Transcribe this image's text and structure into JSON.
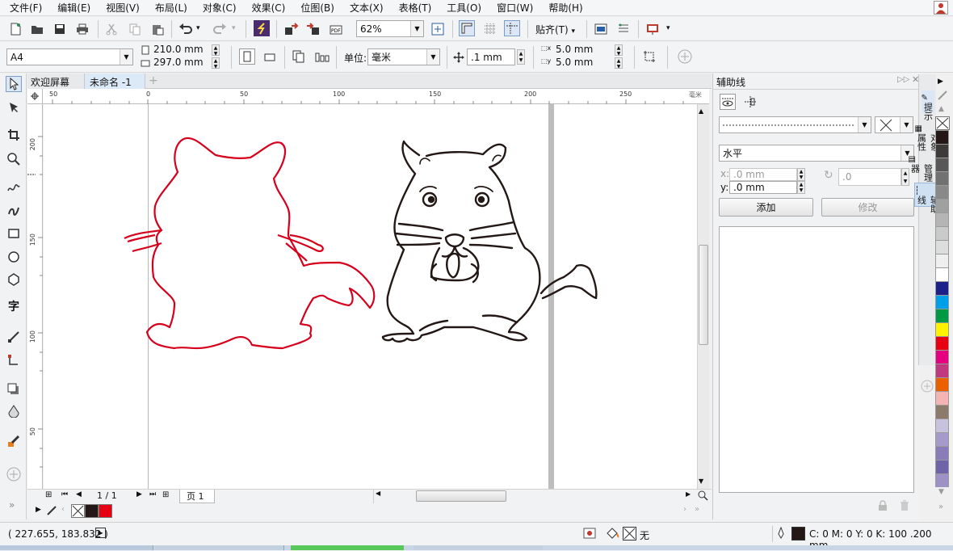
{
  "menu": [
    "文件(F)",
    "编辑(E)",
    "视图(V)",
    "布局(L)",
    "对象(C)",
    "效果(C)",
    "位图(B)",
    "文本(X)",
    "表格(T)",
    "工具(O)",
    "窗口(W)",
    "帮助(H)"
  ],
  "toolbar": {
    "zoom": "62%",
    "snap": "贴齐(T)"
  },
  "property_bar": {
    "page_size": "A4",
    "width": "210.0 mm",
    "height": "297.0 mm",
    "unit_label": "单位:",
    "unit": "毫米",
    "nudge": ".1 mm",
    "dup_x": "5.0 mm",
    "dup_y": "5.0 mm"
  },
  "tabs": [
    "欢迎屏幕",
    "未命名 -1"
  ],
  "ruler_h": [
    "50",
    "0",
    "50",
    "100",
    "150",
    "200",
    "250"
  ],
  "ruler_v": [
    "200",
    "150",
    "100",
    "50"
  ],
  "page_nav": {
    "counter": "1 / 1",
    "page_tab": "页 1"
  },
  "docker": {
    "title": "辅助线",
    "orientation": "水平",
    "x_label": "x:",
    "x_value": ".0 mm",
    "y_label": "y:",
    "y_value": ".0 mm",
    "angle_value": ".0",
    "add_label": "添加",
    "modify_label": "修改"
  },
  "side_tabs": [
    "提示",
    "对象属性",
    "对象管理器",
    "辅助线"
  ],
  "palette": [
    "#231815",
    "#3e3a39",
    "#595757",
    "#727171",
    "#898989",
    "#9fa0a0",
    "#b5b5b6",
    "#c9caca",
    "#dcdddd",
    "#efefef",
    "#ffffff",
    "#1d2088",
    "#00a0e9",
    "#009944",
    "#fff100",
    "#e60012",
    "#e4007f",
    "#c0387d",
    "#eb6100",
    "#f3b4b3",
    "#8c7a6b",
    "#c8c2dd",
    "#a59aca",
    "#8a7cb8",
    "#6f64a9",
    "#9d91c6"
  ],
  "doc_palette": [
    "#231815",
    "#e60012"
  ],
  "status": {
    "coords": "( 227.655, 183.832 )",
    "fill": "无",
    "outline": "C: 0 M: 0 Y: 0 K: 100  .200 mm"
  }
}
